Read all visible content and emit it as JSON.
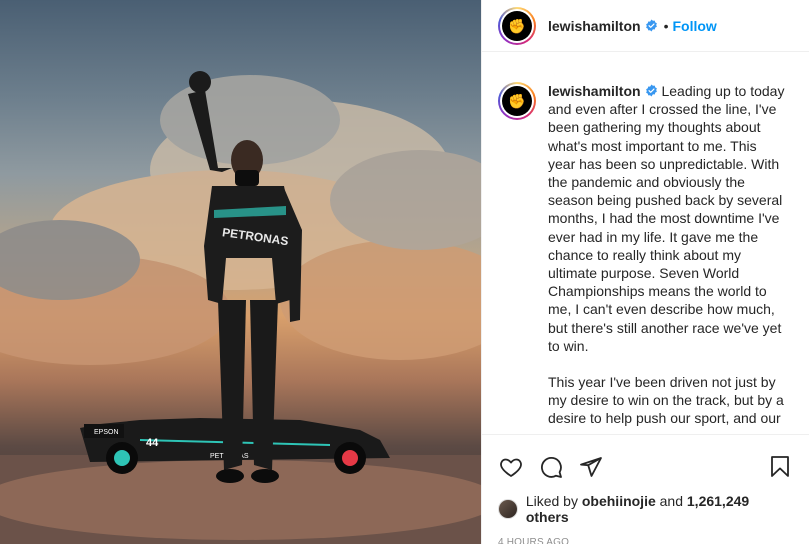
{
  "post": {
    "username": "lewishamilton",
    "follow_label": "Follow",
    "dot": "•",
    "avatar_glyph": "✊",
    "caption_paragraphs": [
      "Leading up to today and even after I crossed the line, I've been gathering my thoughts about what's most important to me. This year has been so unpredictable. With the pandemic and obviously the season being pushed back by several months, I had the most downtime I've ever had in my life. It gave me the chance to really think about my ultimate purpose. Seven World Championships means the world to me, I can't even describe how much, but there's still another race we've yet to win.",
      "This year I've been driven not just by my desire to win on the track, but by a desire to help push our sport, and our"
    ],
    "likes": {
      "prefix": "Liked by",
      "liker": "obehiinojie",
      "and": "and",
      "others": "1,261,249 others"
    },
    "timestamp": "4 HOURS AGO"
  },
  "photo": {
    "suit_text": "PETRONAS",
    "car_number": "44",
    "car_text_left": "EPSON",
    "car_text_side": "PETRONAS"
  },
  "colors": {
    "accent": "#0095f6",
    "verified": "#3897f0",
    "text": "#262626",
    "muted": "#8e8e8e",
    "border": "#efefef"
  },
  "icons": [
    "heart-icon",
    "comment-icon",
    "share-icon",
    "bookmark-icon",
    "verified-icon",
    "raised-fist-icon"
  ]
}
